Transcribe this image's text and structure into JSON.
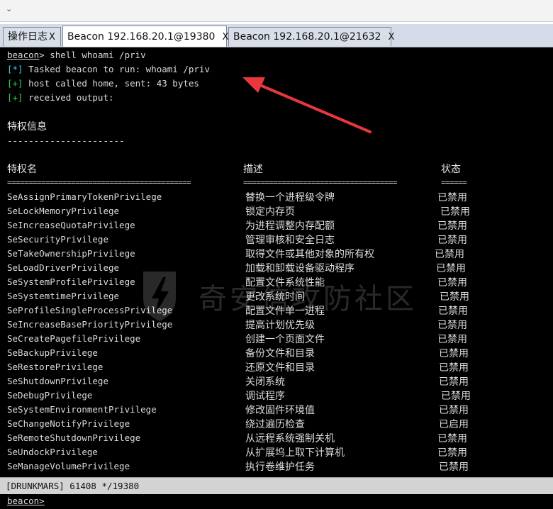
{
  "tabs": [
    {
      "label": "操作日志",
      "close": "X"
    },
    {
      "label": "Beacon 192.168.20.1@19380",
      "close": "X"
    },
    {
      "label": "Beacon 192.168.20.1@21632",
      "close": "X"
    }
  ],
  "console": {
    "prompt": "beacon",
    "command": "> shell whoami /priv",
    "tasked_tag": "[*]",
    "tasked_text": " Tasked beacon to run: whoami /priv",
    "sent_tag": "[+]",
    "sent_text": " host called home, sent: 43 bytes",
    "recv_tag": "[+]",
    "recv_text": " received output:",
    "section_title": "特权信息",
    "section_rule": "----------------------",
    "col_name": "特权名",
    "col_desc": "描述",
    "col_state": "状态",
    "rule_name": "===========================================",
    "rule_desc": "====================================",
    "rule_state": "======"
  },
  "privileges": [
    {
      "name": "SeAssignPrimaryTokenPrivilege",
      "desc": "替换一个进程级令牌",
      "state": "已禁用"
    },
    {
      "name": "SeLockMemoryPrivilege",
      "desc": "锁定内存页",
      "state": "已禁用"
    },
    {
      "name": "SeIncreaseQuotaPrivilege",
      "desc": "为进程调整内存配额",
      "state": "已禁用"
    },
    {
      "name": "SeSecurityPrivilege",
      "desc": "管理审核和安全日志",
      "state": "已禁用"
    },
    {
      "name": "SeTakeOwnershipPrivilege",
      "desc": "取得文件或其他对象的所有权",
      "state": "已禁用"
    },
    {
      "name": "SeLoadDriverPrivilege",
      "desc": "加载和卸载设备驱动程序",
      "state": "已禁用"
    },
    {
      "name": "SeSystemProfilePrivilege",
      "desc": "配置文件系统性能",
      "state": "已禁用"
    },
    {
      "name": "SeSystemtimePrivilege",
      "desc": "更改系统时间",
      "state": "已禁用"
    },
    {
      "name": "SeProfileSingleProcessPrivilege",
      "desc": "配置文件单一进程",
      "state": "已禁用"
    },
    {
      "name": "SeIncreaseBasePriorityPrivilege",
      "desc": "提高计划优先级",
      "state": "已禁用"
    },
    {
      "name": "SeCreatePagefilePrivilege",
      "desc": "创建一个页面文件",
      "state": "已禁用"
    },
    {
      "name": "SeBackupPrivilege",
      "desc": "备份文件和目录",
      "state": "已禁用"
    },
    {
      "name": "SeRestorePrivilege",
      "desc": "还原文件和目录",
      "state": "已禁用"
    },
    {
      "name": "SeShutdownPrivilege",
      "desc": "关闭系统",
      "state": "已禁用"
    },
    {
      "name": "SeDebugPrivilege",
      "desc": "调试程序",
      "state": "已禁用"
    },
    {
      "name": "SeSystemEnvironmentPrivilege",
      "desc": "修改固件环境值",
      "state": "已禁用"
    },
    {
      "name": "SeChangeNotifyPrivilege",
      "desc": "绕过遍历检查",
      "state": "已启用"
    },
    {
      "name": "SeRemoteShutdownPrivilege",
      "desc": "从远程系统强制关机",
      "state": "已禁用"
    },
    {
      "name": "SeUndockPrivilege",
      "desc": "从扩展坞上取下计算机",
      "state": "已禁用"
    },
    {
      "name": "SeManageVolumePrivilege",
      "desc": "执行卷维护任务",
      "state": "已禁用"
    }
  ],
  "watermark": "奇安信攻防社区",
  "status": "[DRUNKMARS] 61408 */19380",
  "input_prompt": "beacon>",
  "colors": {
    "terminal_bg": "#000000",
    "info_cyan": "#45c8e6",
    "ok_green": "#32d24a",
    "annotation_arrow": "#e8383d"
  }
}
